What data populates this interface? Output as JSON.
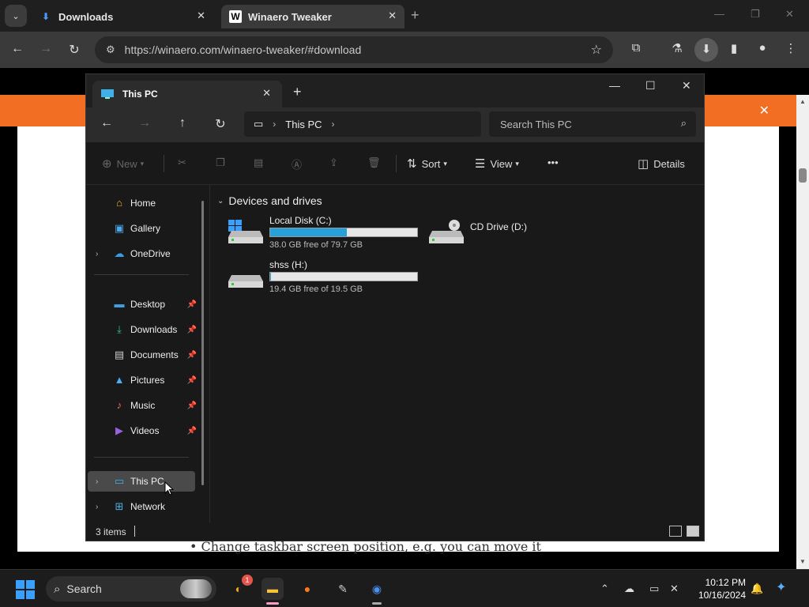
{
  "browser": {
    "tabs": [
      {
        "label": "Downloads",
        "close": "✕"
      },
      {
        "label": "Winaero Tweaker",
        "close": "✕"
      }
    ],
    "new_tab": "+",
    "url": "https://winaero.com/winaero-tweaker/#download",
    "fav_letter": "W"
  },
  "webpage": {
    "banner_close": "✕",
    "bullet_text": "• Change taskbar screen position, e.g. you can move it",
    "accent": "#f26e22"
  },
  "explorer": {
    "tab_title": "This PC",
    "tab_close": "✕",
    "new_tab": "+",
    "breadcrumb": "This PC",
    "search_placeholder": "Search This PC",
    "commands": {
      "new": "New",
      "sort": "Sort",
      "view": "View",
      "more": "•••",
      "details": "Details"
    },
    "sidebar": {
      "top": [
        {
          "label": "Home",
          "icon": "home-icon"
        },
        {
          "label": "Gallery",
          "icon": "gallery-icon"
        },
        {
          "label": "OneDrive",
          "icon": "onedrive-icon"
        }
      ],
      "pinned": [
        {
          "label": "Desktop",
          "icon": "desktop-icon"
        },
        {
          "label": "Downloads",
          "icon": "downloads-icon"
        },
        {
          "label": "Documents",
          "icon": "documents-icon"
        },
        {
          "label": "Pictures",
          "icon": "pictures-icon"
        },
        {
          "label": "Music",
          "icon": "music-icon"
        },
        {
          "label": "Videos",
          "icon": "videos-icon"
        }
      ],
      "bottom": [
        {
          "label": "This PC",
          "icon": "this-pc-icon"
        },
        {
          "label": "Network",
          "icon": "network-icon"
        }
      ]
    },
    "section_title": "Devices and drives",
    "drives": [
      {
        "name": "Local Disk (C:)",
        "free": "38.0 GB free of 79.7 GB",
        "used_fraction": 0.523
      },
      {
        "name": "CD Drive (D:)"
      },
      {
        "name": "shss (H:)",
        "free": "19.4 GB free of 19.5 GB",
        "used_fraction": 0.005
      }
    ],
    "status": "3 items"
  },
  "taskbar": {
    "search_label": "Search",
    "badge": "1",
    "time": "10:12 PM",
    "date": "10/16/2024"
  }
}
